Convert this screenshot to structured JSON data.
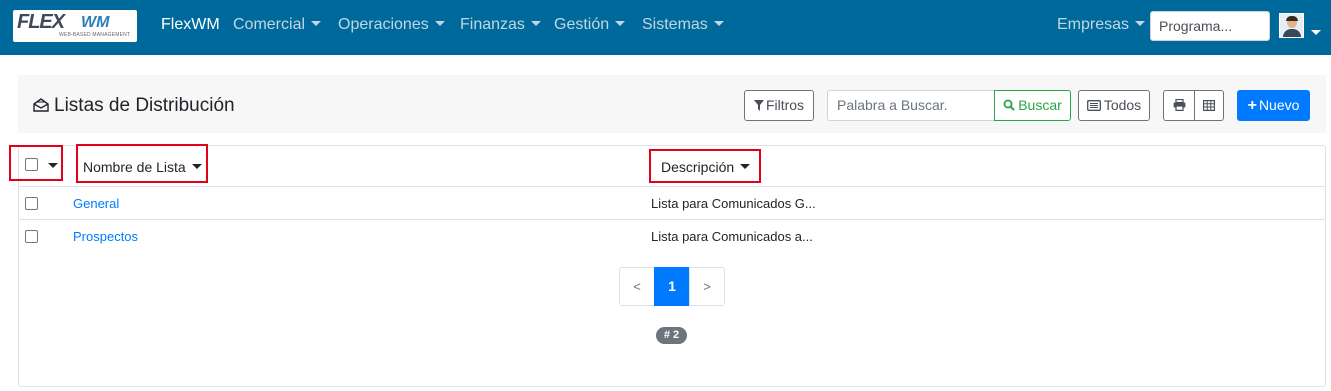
{
  "navbar": {
    "logo_main": "FLEX",
    "logo_secondary": "WM",
    "logo_tagline": "WEB-BASED MANAGEMENT",
    "brand": "FlexWM",
    "menus": [
      "Comercial",
      "Operaciones",
      "Finanzas",
      "Gestión",
      "Sistemas"
    ],
    "empresas": "Empresas",
    "program_input": "Programa...",
    "bg_color": "#00699b"
  },
  "header": {
    "title": "Listas de Distribución",
    "filtros": "Filtros",
    "search_placeholder": "Palabra a Buscar.",
    "buscar": "Buscar",
    "todos": "Todos",
    "nuevo": "Nuevo"
  },
  "table": {
    "columns": [
      "Nombre de Lista",
      "Descripción"
    ],
    "rows": [
      {
        "name": "General",
        "description": "Lista para Comunicados G..."
      },
      {
        "name": "Prospectos",
        "description": "Lista para Comunicados a..."
      }
    ]
  },
  "pagination": {
    "prev": "<",
    "current": "1",
    "next": ">",
    "total_badge": "# 2"
  },
  "colors": {
    "primary": "#007bff",
    "success": "#28a745",
    "highlight": "#e3001b"
  }
}
